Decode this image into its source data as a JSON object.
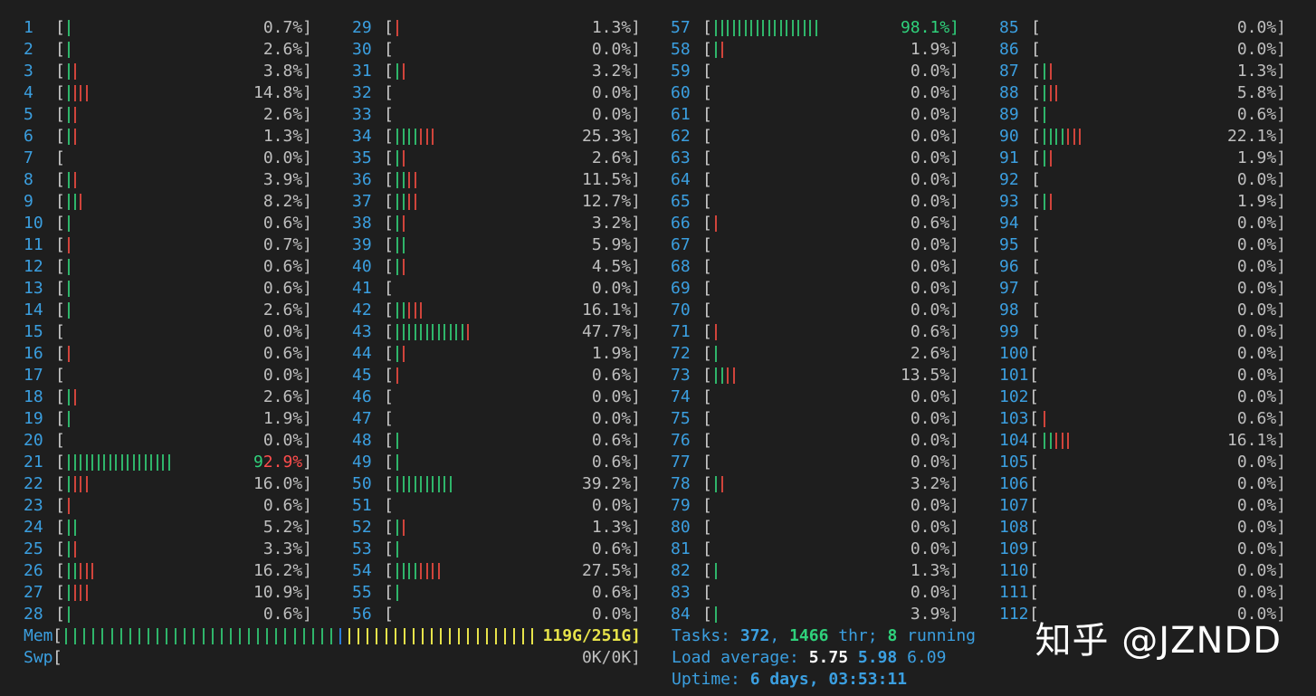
{
  "cpu_columns": [
    [
      {
        "n": "1",
        "g": 1,
        "r": 0,
        "pct": "0.7%]"
      },
      {
        "n": "2",
        "g": 1,
        "r": 0,
        "pct": "2.6%]"
      },
      {
        "n": "3",
        "g": 1,
        "r": 1,
        "pct": "3.8%]"
      },
      {
        "n": "4",
        "g": 1,
        "r": 3,
        "pct": "14.8%]"
      },
      {
        "n": "5",
        "g": 1,
        "r": 1,
        "pct": "2.6%]"
      },
      {
        "n": "6",
        "g": 1,
        "r": 1,
        "pct": "1.3%]"
      },
      {
        "n": "7",
        "g": 0,
        "r": 0,
        "pct": "0.0%]"
      },
      {
        "n": "8",
        "g": 1,
        "r": 1,
        "pct": "3.9%]"
      },
      {
        "n": "9",
        "g": 2,
        "r": 1,
        "pct": "8.2%]"
      },
      {
        "n": "10",
        "g": 1,
        "r": 0,
        "pct": "0.6%]"
      },
      {
        "n": "11",
        "g": 0,
        "r": 1,
        "pct": "0.7%]"
      },
      {
        "n": "12",
        "g": 1,
        "r": 0,
        "pct": "0.6%]"
      },
      {
        "n": "13",
        "g": 1,
        "r": 0,
        "pct": "0.6%]"
      },
      {
        "n": "14",
        "g": 1,
        "r": 0,
        "pct": "2.6%]"
      },
      {
        "n": "15",
        "g": 0,
        "r": 0,
        "pct": "0.0%]"
      },
      {
        "n": "16",
        "g": 0,
        "r": 1,
        "pct": "0.6%]"
      },
      {
        "n": "17",
        "g": 0,
        "r": 0,
        "pct": "0.0%]"
      },
      {
        "n": "18",
        "g": 1,
        "r": 1,
        "pct": "2.6%]"
      },
      {
        "n": "19",
        "g": 1,
        "r": 0,
        "pct": "1.9%]"
      },
      {
        "n": "20",
        "g": 0,
        "r": 0,
        "pct": "0.0%]"
      },
      {
        "n": "21",
        "g": 18,
        "r": 0,
        "pct": "92.9%]",
        "hot": "split"
      },
      {
        "n": "22",
        "g": 1,
        "r": 3,
        "pct": "16.0%]"
      },
      {
        "n": "23",
        "g": 0,
        "r": 1,
        "pct": "0.6%]"
      },
      {
        "n": "24",
        "g": 2,
        "r": 0,
        "pct": "5.2%]"
      },
      {
        "n": "25",
        "g": 1,
        "r": 1,
        "pct": "3.3%]"
      },
      {
        "n": "26",
        "g": 2,
        "r": 3,
        "pct": "16.2%]"
      },
      {
        "n": "27",
        "g": 1,
        "r": 3,
        "pct": "10.9%]"
      },
      {
        "n": "28",
        "g": 1,
        "r": 0,
        "pct": "0.6%]"
      }
    ],
    [
      {
        "n": "29",
        "g": 0,
        "r": 1,
        "pct": "1.3%]"
      },
      {
        "n": "30",
        "g": 0,
        "r": 0,
        "pct": "0.0%]"
      },
      {
        "n": "31",
        "g": 1,
        "r": 1,
        "pct": "3.2%]"
      },
      {
        "n": "32",
        "g": 0,
        "r": 0,
        "pct": "0.0%]"
      },
      {
        "n": "33",
        "g": 0,
        "r": 0,
        "pct": "0.0%]"
      },
      {
        "n": "34",
        "g": 4,
        "r": 3,
        "pct": "25.3%]"
      },
      {
        "n": "35",
        "g": 1,
        "r": 1,
        "pct": "2.6%]"
      },
      {
        "n": "36",
        "g": 2,
        "r": 2,
        "pct": "11.5%]"
      },
      {
        "n": "37",
        "g": 2,
        "r": 2,
        "pct": "12.7%]"
      },
      {
        "n": "38",
        "g": 1,
        "r": 1,
        "pct": "3.2%]"
      },
      {
        "n": "39",
        "g": 2,
        "r": 0,
        "pct": "5.9%]"
      },
      {
        "n": "40",
        "g": 1,
        "r": 1,
        "pct": "4.5%]"
      },
      {
        "n": "41",
        "g": 0,
        "r": 0,
        "pct": "0.0%]"
      },
      {
        "n": "42",
        "g": 2,
        "r": 3,
        "pct": "16.1%]"
      },
      {
        "n": "43",
        "g": 12,
        "r": 1,
        "pct": "47.7%]"
      },
      {
        "n": "44",
        "g": 1,
        "r": 1,
        "pct": "1.9%]"
      },
      {
        "n": "45",
        "g": 0,
        "r": 1,
        "pct": "0.6%]"
      },
      {
        "n": "46",
        "g": 0,
        "r": 0,
        "pct": "0.0%]"
      },
      {
        "n": "47",
        "g": 0,
        "r": 0,
        "pct": "0.0%]"
      },
      {
        "n": "48",
        "g": 1,
        "r": 0,
        "pct": "0.6%]"
      },
      {
        "n": "49",
        "g": 1,
        "r": 0,
        "pct": "0.6%]"
      },
      {
        "n": "50",
        "g": 10,
        "r": 0,
        "pct": "39.2%]"
      },
      {
        "n": "51",
        "g": 0,
        "r": 0,
        "pct": "0.0%]"
      },
      {
        "n": "52",
        "g": 1,
        "r": 1,
        "pct": "1.3%]"
      },
      {
        "n": "53",
        "g": 1,
        "r": 0,
        "pct": "0.6%]"
      },
      {
        "n": "54",
        "g": 4,
        "r": 4,
        "pct": "27.5%]"
      },
      {
        "n": "55",
        "g": 1,
        "r": 0,
        "pct": "0.6%]"
      },
      {
        "n": "56",
        "g": 0,
        "r": 0,
        "pct": "0.0%]"
      }
    ],
    [
      {
        "n": "57",
        "g": 18,
        "r": 0,
        "pct": "98.1%]",
        "hot": "green"
      },
      {
        "n": "58",
        "g": 1,
        "r": 1,
        "pct": "1.9%]"
      },
      {
        "n": "59",
        "g": 0,
        "r": 0,
        "pct": "0.0%]"
      },
      {
        "n": "60",
        "g": 0,
        "r": 0,
        "pct": "0.0%]"
      },
      {
        "n": "61",
        "g": 0,
        "r": 0,
        "pct": "0.0%]"
      },
      {
        "n": "62",
        "g": 0,
        "r": 0,
        "pct": "0.0%]"
      },
      {
        "n": "63",
        "g": 0,
        "r": 0,
        "pct": "0.0%]"
      },
      {
        "n": "64",
        "g": 0,
        "r": 0,
        "pct": "0.0%]"
      },
      {
        "n": "65",
        "g": 0,
        "r": 0,
        "pct": "0.0%]"
      },
      {
        "n": "66",
        "g": 0,
        "r": 1,
        "pct": "0.6%]"
      },
      {
        "n": "67",
        "g": 0,
        "r": 0,
        "pct": "0.0%]"
      },
      {
        "n": "68",
        "g": 0,
        "r": 0,
        "pct": "0.0%]"
      },
      {
        "n": "69",
        "g": 0,
        "r": 0,
        "pct": "0.0%]"
      },
      {
        "n": "70",
        "g": 0,
        "r": 0,
        "pct": "0.0%]"
      },
      {
        "n": "71",
        "g": 0,
        "r": 1,
        "pct": "0.6%]"
      },
      {
        "n": "72",
        "g": 1,
        "r": 0,
        "pct": "2.6%]"
      },
      {
        "n": "73",
        "g": 2,
        "r": 2,
        "pct": "13.5%]"
      },
      {
        "n": "74",
        "g": 0,
        "r": 0,
        "pct": "0.0%]"
      },
      {
        "n": "75",
        "g": 0,
        "r": 0,
        "pct": "0.0%]"
      },
      {
        "n": "76",
        "g": 0,
        "r": 0,
        "pct": "0.0%]"
      },
      {
        "n": "77",
        "g": 0,
        "r": 0,
        "pct": "0.0%]"
      },
      {
        "n": "78",
        "g": 1,
        "r": 1,
        "pct": "3.2%]"
      },
      {
        "n": "79",
        "g": 0,
        "r": 0,
        "pct": "0.0%]"
      },
      {
        "n": "80",
        "g": 0,
        "r": 0,
        "pct": "0.0%]"
      },
      {
        "n": "81",
        "g": 0,
        "r": 0,
        "pct": "0.0%]"
      },
      {
        "n": "82",
        "g": 1,
        "r": 0,
        "pct": "1.3%]"
      },
      {
        "n": "83",
        "g": 0,
        "r": 0,
        "pct": "0.0%]"
      },
      {
        "n": "84",
        "g": 1,
        "r": 0,
        "pct": "3.9%]"
      }
    ],
    [
      {
        "n": "85",
        "g": 0,
        "r": 0,
        "pct": "0.0%]"
      },
      {
        "n": "86",
        "g": 0,
        "r": 0,
        "pct": "0.0%]"
      },
      {
        "n": "87",
        "g": 1,
        "r": 1,
        "pct": "1.3%]"
      },
      {
        "n": "88",
        "g": 1,
        "r": 2,
        "pct": "5.8%]"
      },
      {
        "n": "89",
        "g": 1,
        "r": 0,
        "pct": "0.6%]"
      },
      {
        "n": "90",
        "g": 4,
        "r": 3,
        "pct": "22.1%]"
      },
      {
        "n": "91",
        "g": 1,
        "r": 1,
        "pct": "1.9%]"
      },
      {
        "n": "92",
        "g": 0,
        "r": 0,
        "pct": "0.0%]"
      },
      {
        "n": "93",
        "g": 1,
        "r": 1,
        "pct": "1.9%]"
      },
      {
        "n": "94",
        "g": 0,
        "r": 0,
        "pct": "0.0%]"
      },
      {
        "n": "95",
        "g": 0,
        "r": 0,
        "pct": "0.0%]"
      },
      {
        "n": "96",
        "g": 0,
        "r": 0,
        "pct": "0.0%]"
      },
      {
        "n": "97",
        "g": 0,
        "r": 0,
        "pct": "0.0%]"
      },
      {
        "n": "98",
        "g": 0,
        "r": 0,
        "pct": "0.0%]"
      },
      {
        "n": "99",
        "g": 0,
        "r": 0,
        "pct": "0.0%]"
      },
      {
        "n": "100",
        "g": 0,
        "r": 0,
        "pct": "0.0%]"
      },
      {
        "n": "101",
        "g": 0,
        "r": 0,
        "pct": "0.0%]"
      },
      {
        "n": "102",
        "g": 0,
        "r": 0,
        "pct": "0.0%]"
      },
      {
        "n": "103",
        "g": 0,
        "r": 1,
        "pct": "0.6%]"
      },
      {
        "n": "104",
        "g": 2,
        "r": 3,
        "pct": "16.1%]"
      },
      {
        "n": "105",
        "g": 0,
        "r": 0,
        "pct": "0.0%]"
      },
      {
        "n": "106",
        "g": 0,
        "r": 0,
        "pct": "0.0%]"
      },
      {
        "n": "107",
        "g": 0,
        "r": 0,
        "pct": "0.0%]"
      },
      {
        "n": "108",
        "g": 0,
        "r": 0,
        "pct": "0.0%]"
      },
      {
        "n": "109",
        "g": 0,
        "r": 0,
        "pct": "0.0%]"
      },
      {
        "n": "110",
        "g": 0,
        "r": 0,
        "pct": "0.0%]"
      },
      {
        "n": "111",
        "g": 0,
        "r": 0,
        "pct": "0.0%]"
      },
      {
        "n": "112",
        "g": 0,
        "r": 0,
        "pct": "0.0%]"
      }
    ]
  ],
  "mem": {
    "label": "Mem",
    "green_bars": 30,
    "blue_bars": 1,
    "yellow_bars": 21,
    "value": "119G/251G]"
  },
  "swp": {
    "label": "Swp",
    "value": "0K/0K]"
  },
  "stats": {
    "tasks_label": "Tasks: ",
    "tasks": "372",
    "sep1": ", ",
    "threads": "1466",
    "thr_label": " thr; ",
    "running": "8",
    "running_label": " running",
    "load_label": "Load average: ",
    "load1": "5.75",
    "load5": "5.98",
    "load15": "6.09",
    "uptime_label": "Uptime: ",
    "uptime": "6 days, 03:53:11"
  },
  "watermark": "知乎 @JZNDD",
  "colors": {
    "background": "#1e1e1e",
    "cpu_number": "#3b9fe0",
    "bar_green": "#2fb56a",
    "bar_red": "#d0443b",
    "bar_blue": "#2a7bd8",
    "bar_yellow": "#e7e34a",
    "percent": "#bfbfbf"
  }
}
